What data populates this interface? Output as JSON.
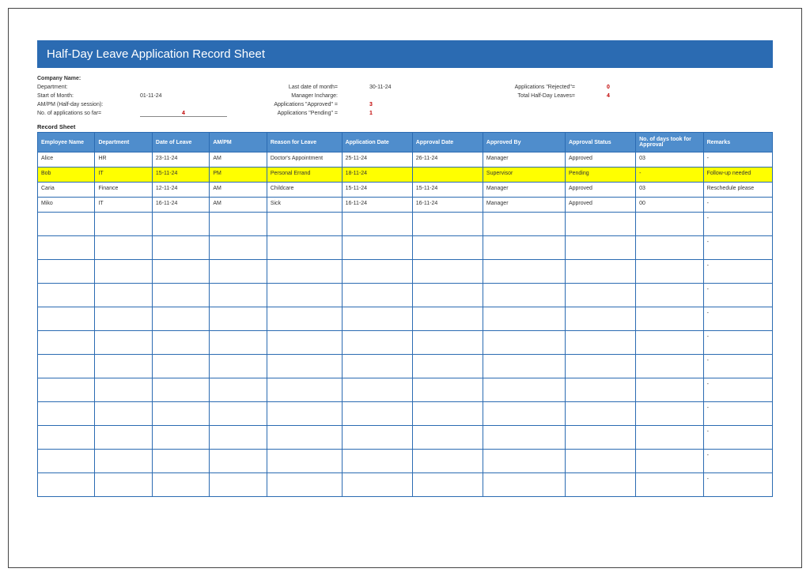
{
  "title": "Half-Day Leave Application Record Sheet",
  "meta": {
    "company_name_label": "Company Name:",
    "department_label": "Department:",
    "start_of_month_label": "Start of Month:",
    "start_of_month_value": "01-11-24",
    "ampm_label": "AM/PM (Half-day session):",
    "no_apps_label": "No. of applications so far=",
    "no_apps_value": "4",
    "last_date_label": "Last date of month=",
    "last_date_value": "30-11-24",
    "manager_label": "Manager Incharge:",
    "approved_label": "Applications \"Approved\" =",
    "approved_value": "3",
    "pending_label": "Applications \"Pending\" =",
    "pending_value": "1",
    "rejected_label": "Applications \"Rejected\"=",
    "rejected_value": "0",
    "total_half_label": "Total Half-Day Leaves=",
    "total_half_value": "4"
  },
  "section_label": "Record Sheet",
  "headers": {
    "c1": "Employee Name",
    "c2": "Department",
    "c3": "Date of Leave",
    "c4": "AM/PM",
    "c5": "Reason for Leave",
    "c6": "Application Date",
    "c7": "Approval Date",
    "c8": "Approved By",
    "c9": "Approval Status",
    "c10": "No. of days took for Approval",
    "c11": "Remarks"
  },
  "rows": [
    {
      "emp": "Alice",
      "dept": "HR",
      "dol": "23-11-24",
      "ampm": "AM",
      "reason": "Doctor's Appointment",
      "app_date": "25-11-24",
      "appr_date": "26-11-24",
      "appr_by": "Manager",
      "status": "Approved",
      "days": "03",
      "remarks": "-",
      "pending": false
    },
    {
      "emp": "Bob",
      "dept": "IT",
      "dol": "15-11-24",
      "ampm": "PM",
      "reason": "Personal Errand",
      "app_date": "18-11-24",
      "appr_date": "",
      "appr_by": "Supervisor",
      "status": "Pending",
      "days": "-",
      "remarks": "Follow-up needed",
      "pending": true
    },
    {
      "emp": "Caria",
      "dept": "Finance",
      "dol": "12-11-24",
      "ampm": "AM",
      "reason": "Childcare",
      "app_date": "15-11-24",
      "appr_date": "15-11-24",
      "appr_by": "Manager",
      "status": "Approved",
      "days": "03",
      "remarks": "Reschedule please",
      "pending": false
    },
    {
      "emp": "Miko",
      "dept": "IT",
      "dol": "16-11-24",
      "ampm": "AM",
      "reason": "Sick",
      "app_date": "16-11-24",
      "appr_date": "16-11-24",
      "appr_by": "Manager",
      "status": "Approved",
      "days": "00",
      "remarks": "-",
      "pending": false
    }
  ],
  "empty_row_count": 12,
  "empty_remark": "-"
}
